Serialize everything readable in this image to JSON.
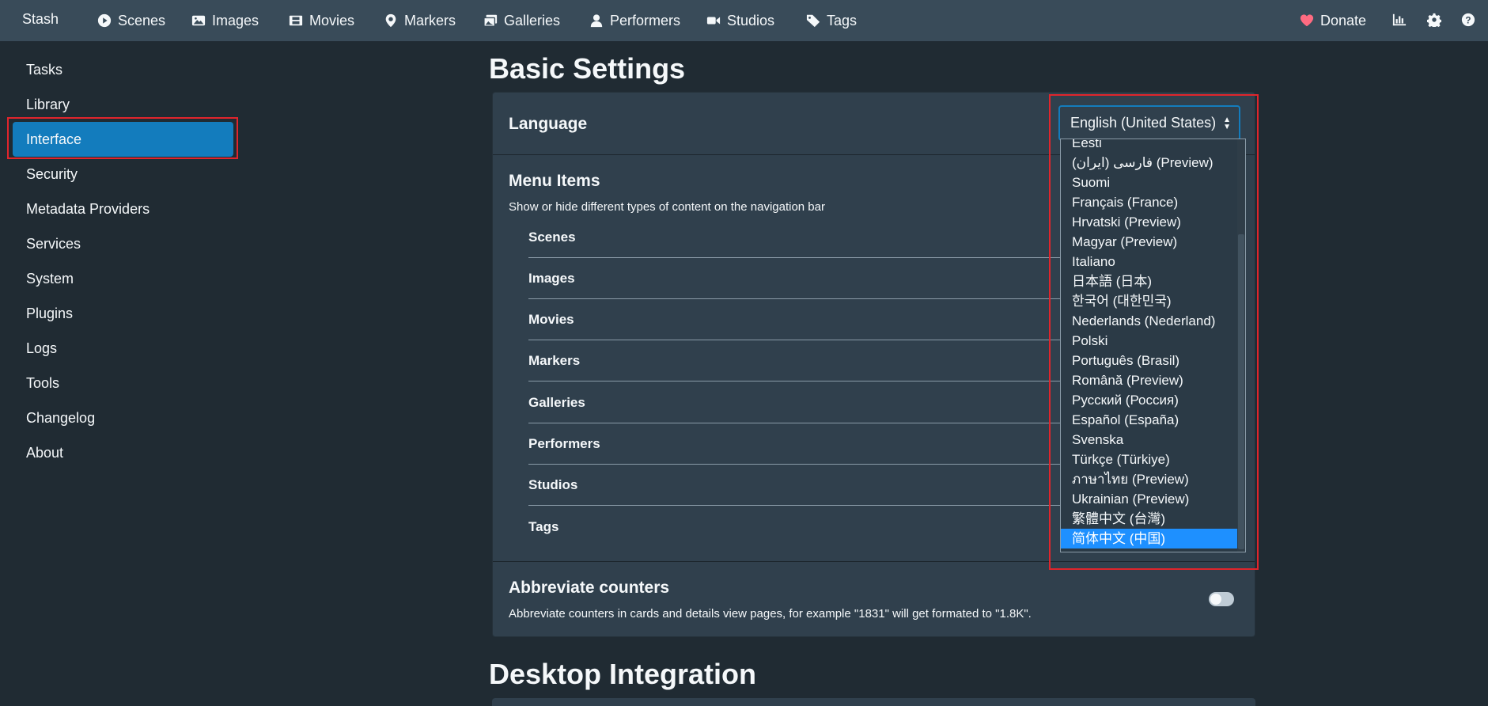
{
  "navbar": {
    "brand": "Stash",
    "items": [
      {
        "label": "Scenes",
        "icon": "play-circle-icon"
      },
      {
        "label": "Images",
        "icon": "image-icon"
      },
      {
        "label": "Movies",
        "icon": "film-icon"
      },
      {
        "label": "Markers",
        "icon": "map-marker-icon"
      },
      {
        "label": "Galleries",
        "icon": "images-icon"
      },
      {
        "label": "Performers",
        "icon": "user-icon"
      },
      {
        "label": "Studios",
        "icon": "video-icon"
      },
      {
        "label": "Tags",
        "icon": "tag-icon"
      }
    ],
    "donate": "Donate"
  },
  "sidebar": {
    "items": [
      {
        "label": "Tasks"
      },
      {
        "label": "Library"
      },
      {
        "label": "Interface"
      },
      {
        "label": "Security"
      },
      {
        "label": "Metadata Providers"
      },
      {
        "label": "Services"
      },
      {
        "label": "System"
      },
      {
        "label": "Plugins"
      },
      {
        "label": "Logs"
      },
      {
        "label": "Tools"
      },
      {
        "label": "Changelog"
      },
      {
        "label": "About"
      }
    ],
    "active": "Interface"
  },
  "main": {
    "basic_title": "Basic Settings",
    "language_label": "Language",
    "language_value": "English (United States)",
    "menu_title": "Menu Items",
    "menu_desc": "Show or hide different types of content on the navigation bar",
    "menu_items": [
      "Scenes",
      "Images",
      "Movies",
      "Markers",
      "Galleries",
      "Performers",
      "Studios",
      "Tags"
    ],
    "abbrev_title": "Abbreviate counters",
    "abbrev_desc": "Abbreviate counters in cards and details view pages, for example \"1831\" will get formated to \"1.8K\".",
    "desktop_title": "Desktop Integration"
  },
  "language_options": [
    "Eesti",
    "فارسی (ایران) (Preview)",
    "Suomi",
    "Français (France)",
    "Hrvatski (Preview)",
    "Magyar (Preview)",
    "Italiano",
    "日本語 (日本)",
    "한국어 (대한민국)",
    "Nederlands (Nederland)",
    "Polski",
    "Português (Brasil)",
    "Română (Preview)",
    "Русский (Россия)",
    "Español (España)",
    "Svenska",
    "Türkçe (Türkiye)",
    "ภาษาไทย (Preview)",
    "Ukrainian (Preview)",
    "繁體中文 (台灣)",
    "简体中文 (中国)"
  ],
  "language_selected_index": 20,
  "colors": {
    "accent": "#137cbd",
    "highlight": "#e0252c",
    "navbar": "#394b59",
    "background": "#202b33",
    "donate_heart": "#ff6b81"
  }
}
